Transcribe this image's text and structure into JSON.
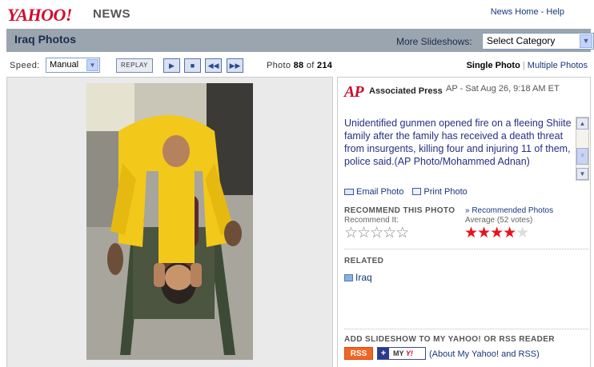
{
  "header": {
    "logo_text": "YAHOO!",
    "section_label": "NEWS",
    "links": [
      "News Home",
      "Help"
    ],
    "link_separator": " - "
  },
  "titlebar": {
    "title": "Iraq Photos",
    "more_label": "More Slideshows:",
    "category_select_value": "Select Category"
  },
  "controls": {
    "speed_label": "Speed:",
    "speed_value": "Manual",
    "replay_label": "REPLAY",
    "play_icon": "play-icon",
    "stop_icon": "stop-icon",
    "previous_icon": "previous-icon",
    "next_icon": "next-icon",
    "photo_label": "Photo",
    "photo_current": "88",
    "photo_of": "of",
    "photo_total": "214",
    "view_single": "Single Photo",
    "view_separator": "|",
    "view_multiple": "Multiple Photos"
  },
  "info": {
    "source_logo_mark": "AP",
    "source_name": "Associated Press",
    "dateline": "AP - Sat Aug 26, 9:18 AM ET",
    "caption": "Unidentified gunmen opened fire on a fleeing Shiite family after the family has received a death threat from insurgents, killing four and injuring 11 of them, police said.(AP Photo/Mohammed Adnan)",
    "email_label": "Email Photo",
    "print_label": "Print Photo",
    "recommend_heading": "RECOMMEND THIS PHOTO",
    "recommended_link": "» Recommended Photos",
    "recommend_it_label": "Recommend It:",
    "average_label": "Average (52 votes)",
    "average_rating": 4,
    "max_rating": 5,
    "related_heading": "RELATED",
    "related_link": "Iraq",
    "add_heading": "ADD SLIDESHOW TO MY YAHOO! OR RSS READER",
    "rss_badge": "RSS",
    "myyahoo_badge_text": "MY",
    "myyahoo_badge_y": "Y!",
    "about_link": "(About My Yahoo! and RSS)"
  },
  "colors": {
    "yahoo_red": "#d3092b",
    "title_bar": "#9aa5af",
    "link_blue": "#16387c",
    "caption_blue": "#262f85",
    "star_red": "#e8131b",
    "rss_orange": "#f26522"
  }
}
